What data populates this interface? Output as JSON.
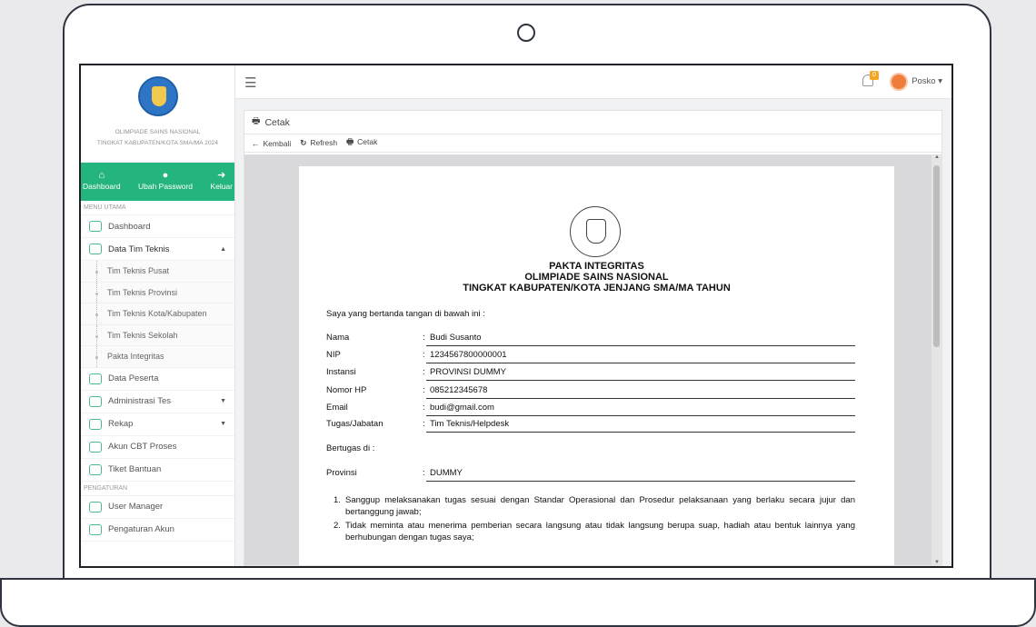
{
  "brand": {
    "line1": "OLIMPIADE SAINS NASIONAL",
    "line2": "TINGKAT KABUPATEN/KOTA SMA/MA 2024"
  },
  "quick_links": [
    {
      "label": "Dashboard",
      "icon": "home-icon"
    },
    {
      "label": "Ubah Password",
      "icon": "user-key-icon"
    },
    {
      "label": "Keluar",
      "icon": "sign-out-icon"
    }
  ],
  "sidebar": {
    "section_main": "MENU UTAMA",
    "section_settings": "PENGATURAN",
    "items": {
      "dashboard": "Dashboard",
      "data_tim_teknis": "Data Tim Teknis",
      "data_peserta": "Data Peserta",
      "administrasi_tes": "Administrasi Tes",
      "rekap": "Rekap",
      "akun_cbt": "Akun CBT Proses",
      "tiket_bantuan": "Tiket Bantuan",
      "user_manager": "User Manager",
      "pengaturan_akun": "Pengaturan Akun"
    },
    "submenu": [
      "Tim Teknis Pusat",
      "Tim Teknis Provinsi",
      "Tim Teknis Kota/Kabupaten",
      "Tim Teknis Sekolah",
      "Pakta Integritas"
    ]
  },
  "topbar": {
    "notification_count": "0",
    "user_name": "Posko ▾"
  },
  "panel": {
    "title": "Cetak",
    "toolbar": {
      "back": "Kembali",
      "refresh": "Refresh",
      "print": "Cetak"
    }
  },
  "document": {
    "title1": "PAKTA INTEGRITAS",
    "title2": "OLIMPIADE SAINS NASIONAL",
    "title3": "TINGKAT KABUPATEN/KOTA JENJANG SMA/MA TAHUN",
    "intro": "Saya yang bertanda tangan di bawah ini :",
    "fields": {
      "nama_label": "Nama",
      "nama": "Budi Susanto",
      "nip_label": "NIP",
      "nip": "1234567800000001",
      "instansi_label": "Instansi",
      "instansi": "PROVINSI DUMMY",
      "hp_label": "Nomor HP",
      "hp": "085212345678",
      "email_label": "Email",
      "email": "budi@gmail.com",
      "jabatan_label": "Tugas/Jabatan",
      "jabatan": "Tim Teknis/Helpdesk",
      "provinsi_label": "Provinsi",
      "provinsi": "DUMMY"
    },
    "colon": ":",
    "bertugas": "Bertugas di :",
    "statements": [
      {
        "num": "1.",
        "text": "Sanggup melaksanakan tugas sesuai dengan Standar Operasional dan Prosedur pelaksanaan yang berlaku secara jujur dan bertanggung jawab;"
      },
      {
        "num": "2.",
        "text": "Tidak meminta atau menerima pemberian secara langsung atau tidak langsung berupa suap, hadiah atau bentuk lainnya yang berhubungan dengan tugas saya;"
      }
    ]
  }
}
